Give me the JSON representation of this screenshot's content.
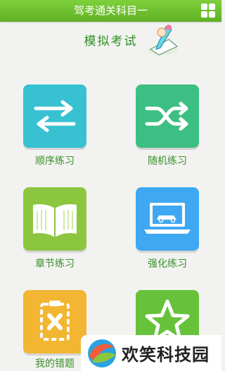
{
  "app": {
    "title": "驾考通关科目一"
  },
  "section": {
    "title": "模拟考试"
  },
  "menu": [
    {
      "label": "顺序练习",
      "icon": "arrows-left-right-icon",
      "color": "#3bbfcf"
    },
    {
      "label": "随机练习",
      "icon": "shuffle-icon",
      "color": "#3fbf86"
    },
    {
      "label": "章节练习",
      "icon": "book-icon",
      "color": "#8cc63f"
    },
    {
      "label": "强化练习",
      "icon": "laptop-car-icon",
      "color": "#3fa9f5"
    },
    {
      "label": "我的错题",
      "icon": "clipboard-x-icon",
      "color": "#f2b632"
    },
    {
      "label": "",
      "icon": "star-icon",
      "color": "#67c23a"
    }
  ],
  "watermark": {
    "text": "欢笑科技园"
  },
  "colors": {
    "accent": "#5fb224",
    "text": "#3a8e2b"
  }
}
